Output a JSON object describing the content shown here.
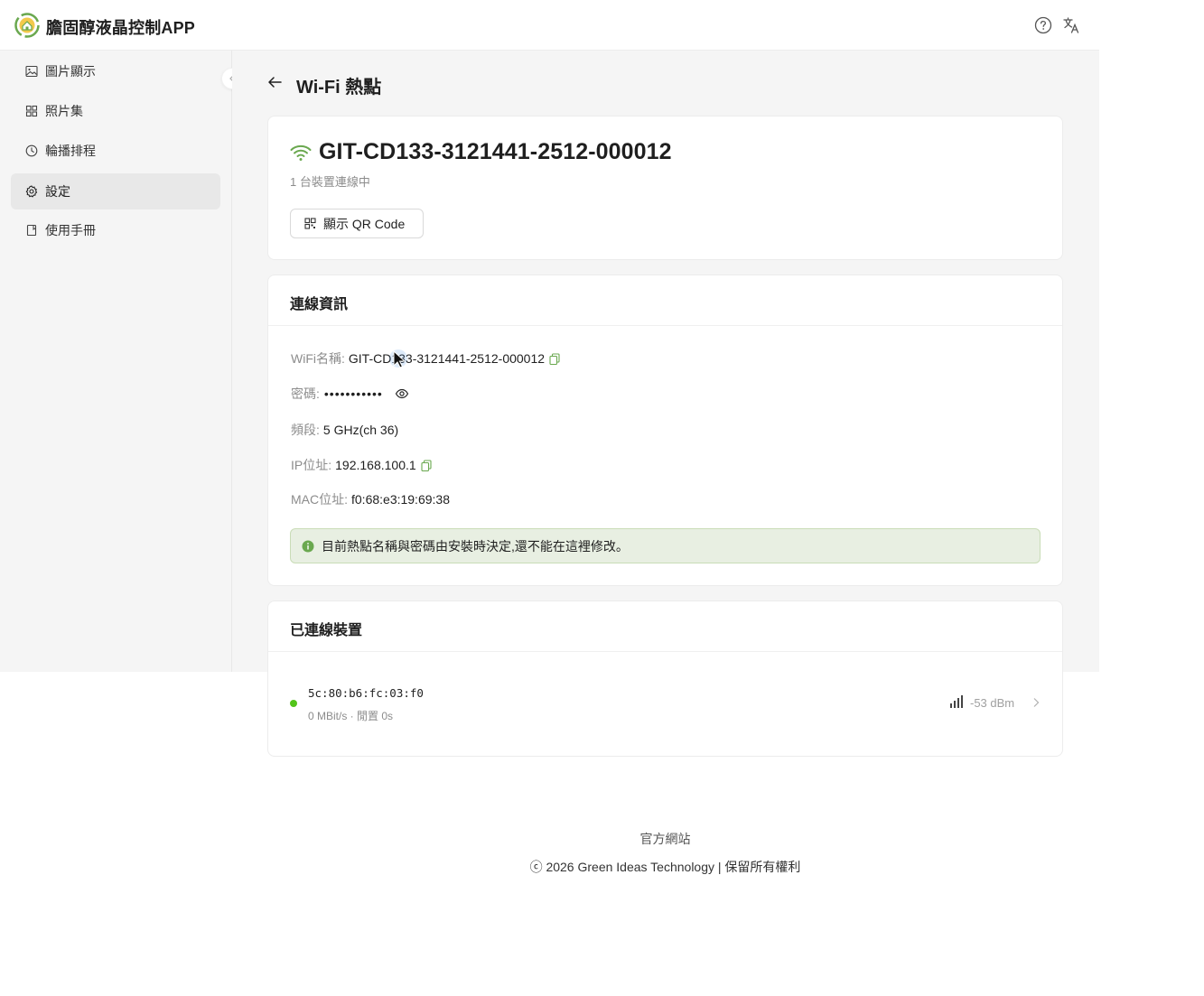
{
  "app": {
    "title": "膽固醇液晶控制APP",
    "brand_color": "#6aa84f"
  },
  "sidebar": {
    "items": [
      {
        "label": "圖片顯示",
        "icon": "image-icon",
        "active": false
      },
      {
        "label": "照片集",
        "icon": "grid-icon",
        "active": false
      },
      {
        "label": "輪播排程",
        "icon": "clock-icon",
        "active": false
      },
      {
        "label": "設定",
        "icon": "gear-icon",
        "active": true
      },
      {
        "label": "使用手冊",
        "icon": "book-icon",
        "active": false
      }
    ]
  },
  "page": {
    "title": "Wi-Fi 熱點"
  },
  "hotspot": {
    "ssid": "GIT-CD133-3121441-2512-000012",
    "connected_text": "1 台裝置連線中",
    "qr_button": "顯示 QR Code"
  },
  "connection": {
    "heading": "連線資訊",
    "wifi_name_label": "WiFi名稱:",
    "wifi_name_value": "GIT-CD133-3121441-2512-000012",
    "password_label": "密碼:",
    "password_value": "•••••••••••",
    "band_label": "頻段:",
    "band_value": "5 GHz(ch 36)",
    "ip_label": "IP位址:",
    "ip_value": "192.168.100.1",
    "mac_label": "MAC位址:",
    "mac_value": "f0:68:e3:19:69:38",
    "notice": "目前熱點名稱與密碼由安裝時決定,還不能在這裡修改。"
  },
  "devices": {
    "heading": "已連線裝置",
    "list": [
      {
        "mac": "5c:80:b6:fc:03:f0",
        "meta": "0 MBit/s · 閒置 0s",
        "signal": "-53 dBm",
        "status_color": "#52c41a"
      }
    ]
  },
  "footer": {
    "link": "官方網站",
    "copyright": "ⓒ 2026 Green Ideas Technology | 保留所有權利"
  }
}
